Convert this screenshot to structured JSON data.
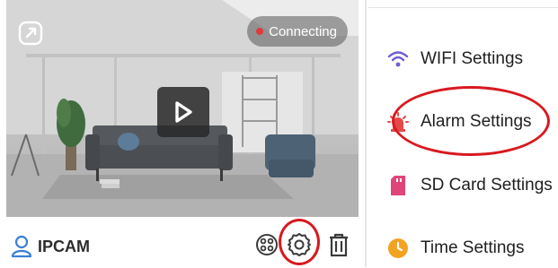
{
  "camera": {
    "status_label": "Connecting",
    "name": "IPCAM",
    "icons": {
      "share": "share-external-icon",
      "play": "play-icon",
      "user": "user-icon",
      "cloud_playback": "cloud-playback-icon",
      "settings": "gear-icon",
      "delete": "trash-icon"
    }
  },
  "settings": {
    "items": [
      {
        "label": "WIFI Settings",
        "icon": "wifi-icon",
        "icon_color": "#6c5dd3"
      },
      {
        "label": "Alarm Settings",
        "icon": "alarm-siren-icon",
        "icon_color": "#e54848"
      },
      {
        "label": "SD Card Settings",
        "icon": "sd-card-icon",
        "icon_color": "#e0457a"
      },
      {
        "label": "Time Settings",
        "icon": "clock-icon",
        "icon_color": "#f2a322"
      }
    ]
  },
  "colors": {
    "highlight": "#d81920",
    "status_dot": "#e0393e"
  }
}
